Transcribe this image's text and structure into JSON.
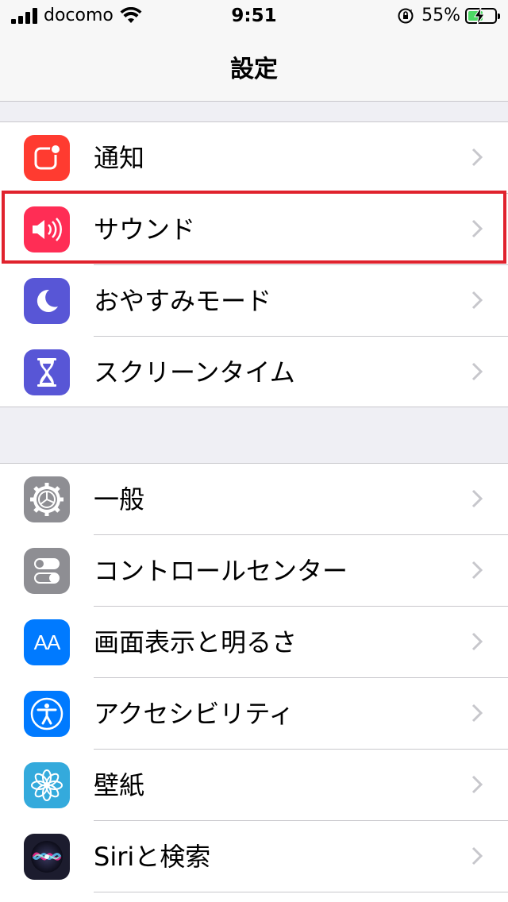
{
  "status_bar": {
    "carrier": "docomo",
    "time": "9:51",
    "battery_percent": "55%",
    "battery_level": 0.55
  },
  "nav": {
    "title": "設定"
  },
  "group1": [
    {
      "label": "通知",
      "icon": "notifications-icon",
      "color": "#ff3b30"
    },
    {
      "label": "サウンド",
      "icon": "speaker-icon",
      "color": "#ff2d55"
    },
    {
      "label": "おやすみモード",
      "icon": "moon-icon",
      "color": "#5856d6"
    },
    {
      "label": "スクリーンタイム",
      "icon": "hourglass-icon",
      "color": "#5856d6"
    }
  ],
  "group2": [
    {
      "label": "一般",
      "icon": "gear-icon",
      "color": "#8e8e93"
    },
    {
      "label": "コントロールセンター",
      "icon": "toggles-icon",
      "color": "#8e8e93"
    },
    {
      "label": "画面表示と明るさ",
      "icon": "text-size-icon",
      "icon_text": "AA",
      "color": "#007aff"
    },
    {
      "label": "アクセシビリティ",
      "icon": "accessibility-icon",
      "color": "#007aff"
    },
    {
      "label": "壁紙",
      "icon": "flower-icon",
      "color": "#34aadc"
    },
    {
      "label": "Siriと検索",
      "icon": "siri-icon",
      "color": "#1c1c2e"
    }
  ],
  "highlight_color": "#e0222d"
}
